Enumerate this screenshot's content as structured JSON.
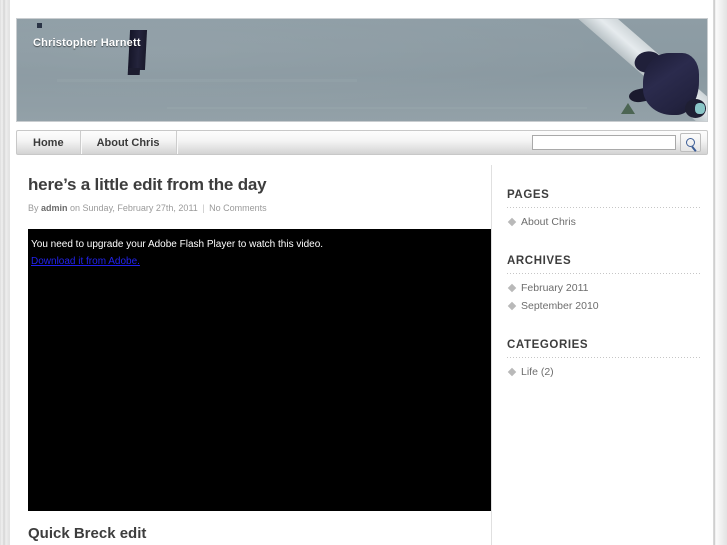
{
  "site": {
    "title": "Christopher Harnett"
  },
  "nav": {
    "items": [
      {
        "label": "Home",
        "name": "nav-home"
      },
      {
        "label": "About Chris",
        "name": "nav-about-chris"
      }
    ],
    "search": {
      "value": "",
      "placeholder": "",
      "button_icon": "search-icon"
    }
  },
  "post": {
    "title": "here’s a little edit from the day",
    "meta": {
      "by_prefix": "By ",
      "author": "admin",
      "date_text": " on Sunday, February 27th, 2011 ",
      "separator": "|",
      "comments": " No Comments"
    },
    "video": {
      "upgrade_message": "You need to upgrade your Adobe Flash Player to watch this video.",
      "download_link": "Download it from Adobe."
    }
  },
  "next_post": {
    "title": "Quick Breck edit"
  },
  "sidebar": {
    "sections": [
      {
        "heading": "PAGES",
        "items": [
          {
            "label": "About Chris"
          }
        ]
      },
      {
        "heading": "ARCHIVES",
        "items": [
          {
            "label": "February 2011"
          },
          {
            "label": "September 2010"
          }
        ]
      },
      {
        "heading": "CATEGORIES",
        "items": [
          {
            "label": "Life (2)"
          }
        ]
      }
    ]
  },
  "colors": {
    "banner_bg": "#8c9ba3",
    "link_blue": "#2222ee",
    "text_dark": "#3d3d3d",
    "text_muted": "#9a9a9a",
    "page_bg": "#e9e9e9"
  }
}
